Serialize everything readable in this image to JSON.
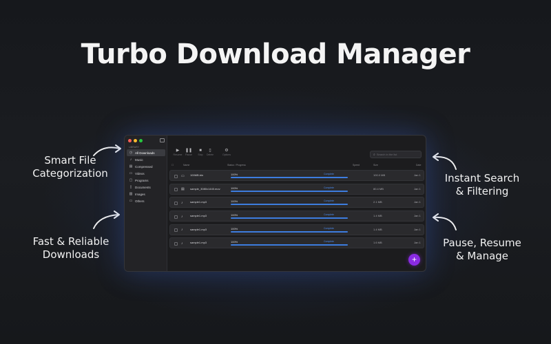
{
  "hero": {
    "title": "Turbo Download Manager"
  },
  "callouts": {
    "smart": [
      "Smart File",
      "Categorization"
    ],
    "fast": [
      "Fast & Reliable",
      "Downloads"
    ],
    "search": [
      "Instant Search",
      "& Filtering"
    ],
    "pause": [
      "Pause, Resume",
      "& Manage"
    ]
  },
  "window": {
    "sidebar_header": "LIBRARY",
    "sidebar": [
      {
        "label": "All Downloads",
        "icon": "downloads-icon",
        "glyph": "◷"
      },
      {
        "label": "Music",
        "icon": "music-icon",
        "glyph": "♪"
      },
      {
        "label": "Compressed",
        "icon": "archive-icon",
        "glyph": "▤"
      },
      {
        "label": "Videos",
        "icon": "video-icon",
        "glyph": "▭"
      },
      {
        "label": "Programs",
        "icon": "programs-icon",
        "glyph": "▢"
      },
      {
        "label": "Documents",
        "icon": "document-icon",
        "glyph": "▯"
      },
      {
        "label": "Images",
        "icon": "image-icon",
        "glyph": "▨"
      },
      {
        "label": "Others",
        "icon": "folder-icon",
        "glyph": "▭"
      }
    ],
    "toolbar": [
      {
        "label": "Resume",
        "icon": "play-icon",
        "glyph": "▶"
      },
      {
        "label": "Pause",
        "icon": "pause-icon",
        "glyph": "❚❚"
      },
      {
        "label": "Stop",
        "icon": "stop-icon",
        "glyph": "■"
      },
      {
        "label": "Delete",
        "icon": "trash-icon",
        "glyph": "▯"
      },
      {
        "label": "Options",
        "icon": "gear-icon",
        "glyph": "⚙"
      }
    ],
    "search_placeholder": "Search in the list",
    "columns": {
      "name": "Name",
      "status": "Status / Progress",
      "speed": "Speed",
      "size": "Size",
      "date": "Date"
    },
    "rows": [
      {
        "name": "100MB.bin",
        "icon": "file-icon",
        "glyph": "▭",
        "progress": "100%",
        "status": "Complete",
        "size": "100.0 MB",
        "date": "Jan 1"
      },
      {
        "name": "sample_3080x1440.mov",
        "icon": "video-icon",
        "glyph": "▤",
        "progress": "100%",
        "status": "Complete",
        "size": "80.4 MB",
        "date": "Jan 1"
      },
      {
        "name": "sample1.mp3",
        "icon": "music-icon",
        "glyph": "♪",
        "progress": "100%",
        "status": "Complete",
        "size": "2.1 MB",
        "date": "Jan 1"
      },
      {
        "name": "sample1.mp3",
        "icon": "music-icon",
        "glyph": "♪",
        "progress": "100%",
        "status": "Complete",
        "size": "1.4 MB",
        "date": "Jan 1"
      },
      {
        "name": "sample1.mp3",
        "icon": "music-icon",
        "glyph": "♪",
        "progress": "100%",
        "status": "Complete",
        "size": "1.4 MB",
        "date": "Jan 1"
      },
      {
        "name": "sample1.mp3",
        "icon": "music-icon",
        "glyph": "♪",
        "progress": "100%",
        "status": "Complete",
        "size": "1.6 MB",
        "date": "Jan 1"
      }
    ],
    "add_button": "+"
  },
  "colors": {
    "accent": "#3d7de0",
    "fab": "#8a2be2"
  }
}
